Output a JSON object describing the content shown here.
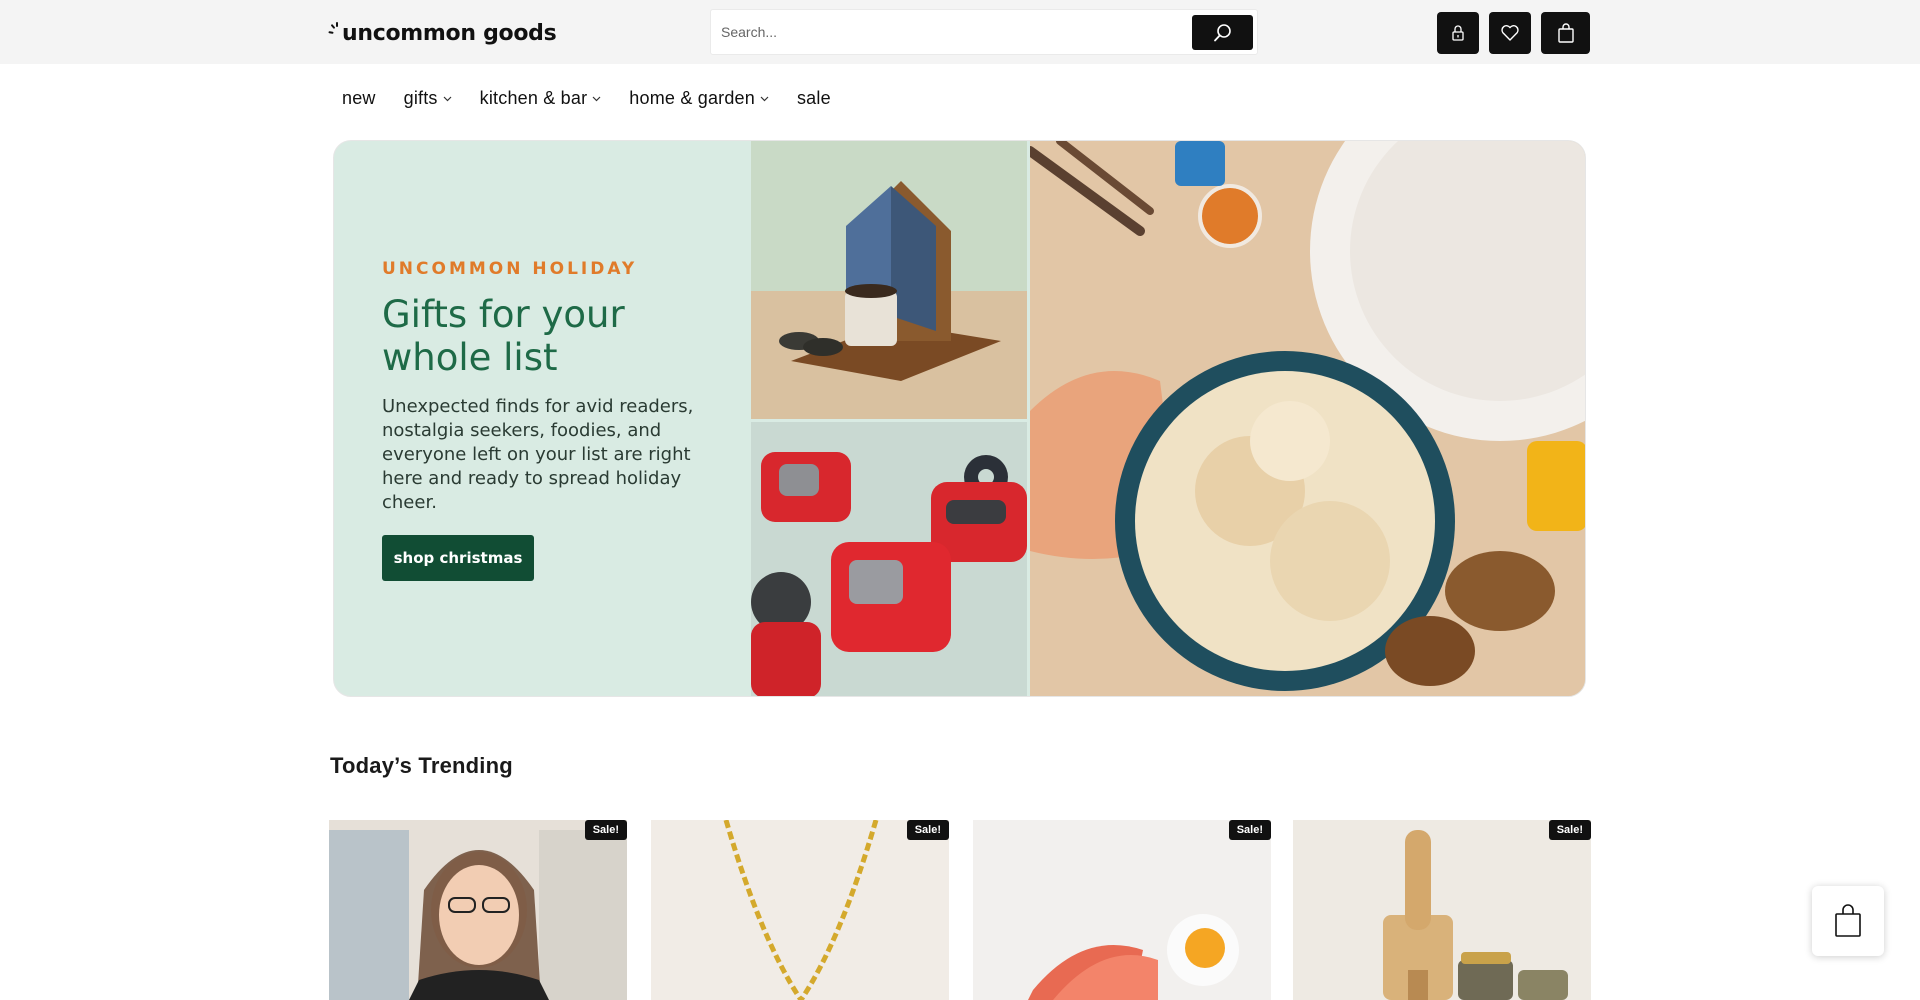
{
  "header": {
    "logo_text": "uncommon goods",
    "search": {
      "placeholder": "Search..."
    },
    "icons": [
      "lock-icon",
      "heart-icon",
      "shopping-bag-icon"
    ]
  },
  "nav": {
    "items": [
      {
        "label": "new",
        "has_dropdown": false
      },
      {
        "label": "gifts",
        "has_dropdown": true
      },
      {
        "label": "kitchen & bar",
        "has_dropdown": true
      },
      {
        "label": "home & garden",
        "has_dropdown": true
      },
      {
        "label": "sale",
        "has_dropdown": false
      }
    ]
  },
  "hero": {
    "eyebrow": "UNCOMMON HOLIDAY",
    "title": "Gifts for your whole list",
    "body": "Unexpected finds for avid readers, nostalgia seekers, foodies, and everyone left on your list are right here and ready to spread holiday cheer.",
    "cta": "shop christmas"
  },
  "trending": {
    "title": "Today’s Trending",
    "products": [
      {
        "badge": "Sale!"
      },
      {
        "badge": "Sale!"
      },
      {
        "badge": "Sale!"
      },
      {
        "badge": "Sale!"
      }
    ]
  },
  "colors": {
    "brand_dark": "#111111",
    "hero_bg": "#d9ebe3",
    "hero_title": "#1e6a47",
    "hero_eyebrow": "#e07b2a",
    "cta_bg": "#114d34"
  }
}
